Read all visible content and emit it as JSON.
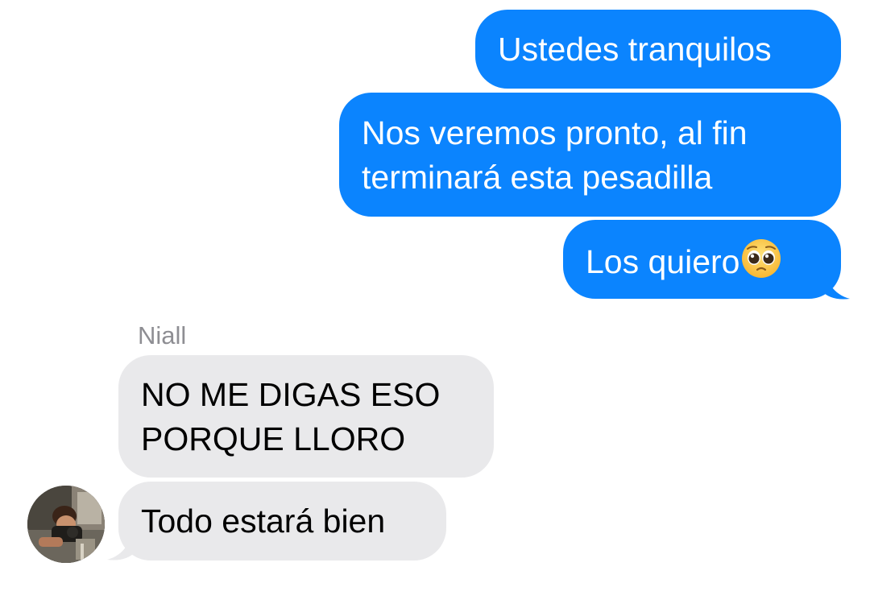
{
  "messages": {
    "outgoing": [
      {
        "lines": [
          "Ustedes tranquilos"
        ]
      },
      {
        "lines": [
          "Nos veremos pronto, al fin",
          "terminará esta pesadilla"
        ]
      },
      {
        "lines": [
          "Los quiero"
        ],
        "emoji": "pleading-face-icon"
      }
    ],
    "incoming": {
      "sender": "Niall",
      "items": [
        {
          "lines": [
            "NO ME DIGAS ESO",
            "PORQUE LLORO"
          ]
        },
        {
          "lines": [
            "Todo estará bien"
          ]
        }
      ]
    }
  },
  "colors": {
    "outgoing_bubble": "#0b84fe",
    "incoming_bubble": "#e9e9eb",
    "sender_name": "#8e8e93"
  }
}
